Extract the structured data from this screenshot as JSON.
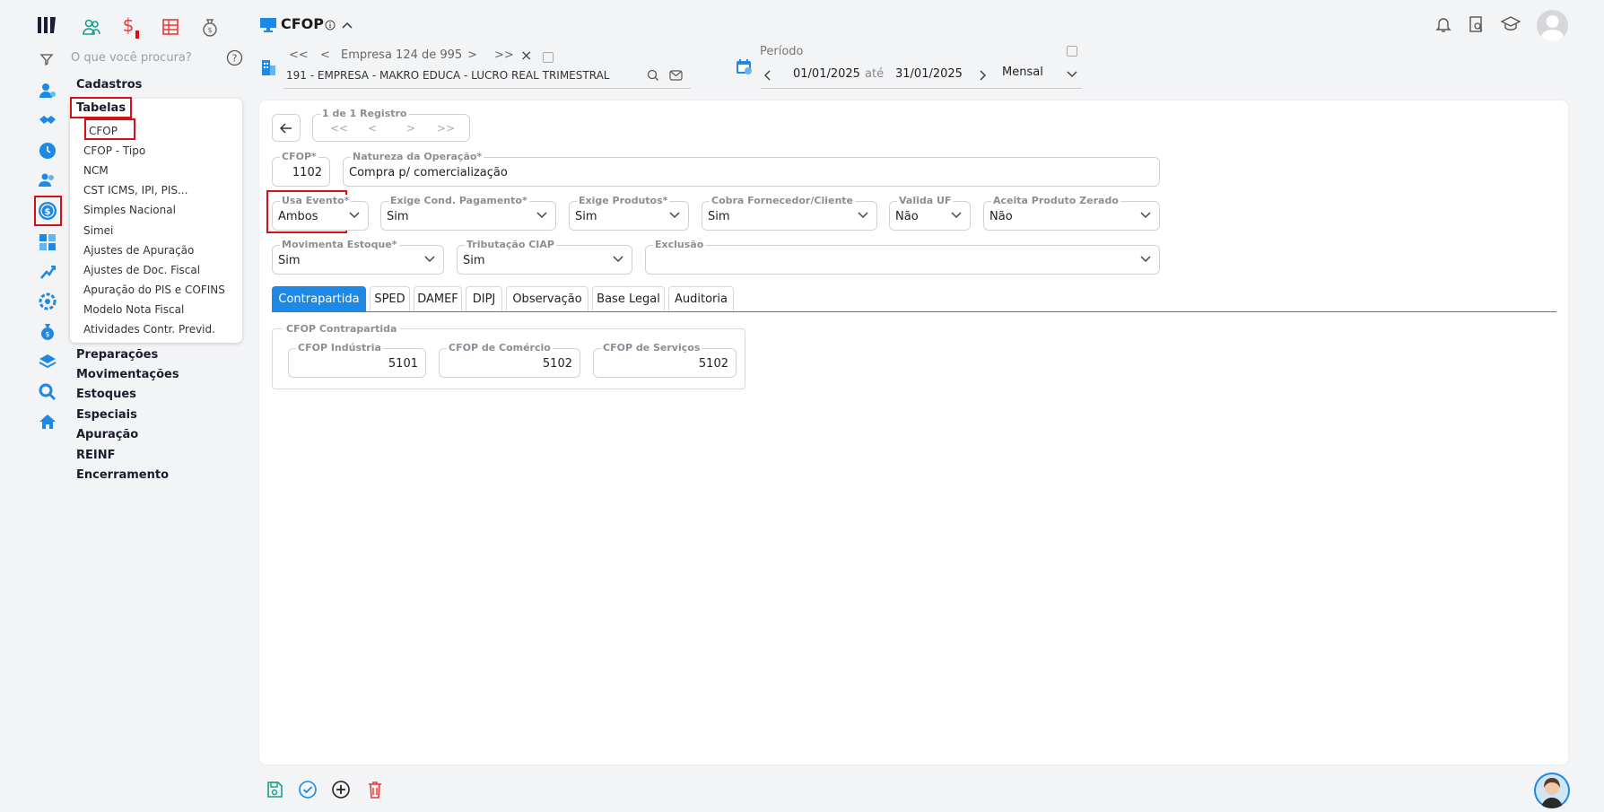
{
  "page": {
    "title": "CFOP"
  },
  "search": {
    "placeholder": "O que você procura?"
  },
  "menu": {
    "cadastros": "Cadastros",
    "tabelas": "Tabelas",
    "tabelas_items": [
      "CFOP",
      "CFOP - Tipo",
      "NCM",
      "CST ICMS, IPI, PIS...",
      "Simples Nacional",
      "Simei",
      "Ajustes de Apuração",
      "Ajustes de Doc. Fiscal",
      "Apuração do PIS e COFINS",
      "Modelo Nota Fiscal",
      "Atividades Contr. Previd."
    ],
    "others": [
      "Preparações",
      "Movimentações",
      "Estoques",
      "Especiais",
      "Apuração",
      "REINF",
      "Encerramento"
    ]
  },
  "empresa": {
    "first": "<<",
    "prev": "<",
    "counter": "Empresa 124 de 995",
    "next": ">",
    "last": ">>",
    "close": "×",
    "name": "191 - EMPRESA - MAKRO EDUCA - LUCRO REAL TRIMESTRAL"
  },
  "periodo": {
    "label": "Período",
    "from": "01/01/2025",
    "sep": "até",
    "to": "31/01/2025",
    "type": "Mensal"
  },
  "registro": {
    "label": "1 de 1 Registro",
    "first": "<<",
    "prev": "<",
    "next": ">",
    "last": ">>"
  },
  "form": {
    "cfop": {
      "label": "CFOP*",
      "value": "1102"
    },
    "natureza": {
      "label": "Natureza da Operação*",
      "value": "Compra p/ comercialização"
    },
    "usa_evento": {
      "label": "Usa Evento*",
      "value": "Ambos"
    },
    "exige_cond": {
      "label": "Exige Cond. Pagamento*",
      "value": "Sim"
    },
    "exige_produtos": {
      "label": "Exige Produtos*",
      "value": "Sim"
    },
    "cobra": {
      "label": "Cobra Fornecedor/Cliente",
      "value": "Sim"
    },
    "valida_uf": {
      "label": "Valida UF",
      "value": "Não"
    },
    "aceita_zerado": {
      "label": "Aceita Produto Zerado",
      "value": "Não"
    },
    "movimenta": {
      "label": "Movimenta Estoque*",
      "value": "Sim"
    },
    "ciap": {
      "label": "Tributação CIAP",
      "value": "Sim"
    },
    "exclusao": {
      "label": "Exclusão",
      "value": ""
    }
  },
  "tabs": [
    "Contrapartida",
    "SPED",
    "DAMEF",
    "DIPJ",
    "Observação",
    "Base Legal",
    "Auditoria"
  ],
  "contrapartida": {
    "title": "CFOP Contrapartida",
    "industria": {
      "label": "CFOP Indústria",
      "value": "5101"
    },
    "comercio": {
      "label": "CFOP de Comércio",
      "value": "5102"
    },
    "servicos": {
      "label": "CFOP de Serviços",
      "value": "5102"
    }
  },
  "colors": {
    "accent": "#1e88e5",
    "highlight": "#d90f16",
    "danger": "#e53935",
    "success": "#16a085"
  }
}
